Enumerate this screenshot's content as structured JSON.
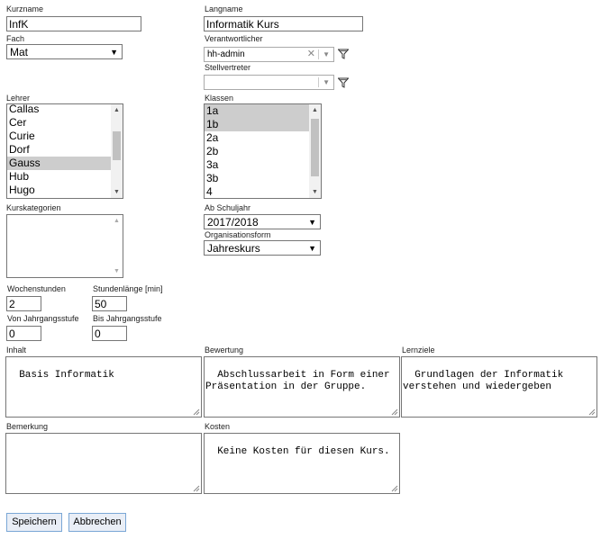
{
  "form": {
    "kurzname": {
      "label": "Kurzname",
      "value": "InfK"
    },
    "langname": {
      "label": "Langname",
      "value": "Informatik Kurs"
    },
    "fach": {
      "label": "Fach",
      "value": "Mat"
    },
    "verantwortlicher": {
      "label": "Verantwortlicher",
      "value": "hh-admin"
    },
    "stellvertreter": {
      "label": "Stellvertreter",
      "value": ""
    },
    "lehrer": {
      "label": "Lehrer",
      "options": [
        "Callas",
        "Cer",
        "Curie",
        "Dorf",
        "Gauss",
        "Hub",
        "Hugo"
      ],
      "selected": [
        "Gauss"
      ]
    },
    "klassen": {
      "label": "Klassen",
      "options": [
        "1a",
        "1b",
        "2a",
        "2b",
        "3a",
        "3b",
        "4"
      ],
      "selected": [
        "1a",
        "1b"
      ]
    },
    "kurskategorien": {
      "label": "Kurskategorien"
    },
    "ab_schuljahr": {
      "label": "Ab Schuljahr",
      "value": "2017/2018"
    },
    "organisationsform": {
      "label": "Organisationsform",
      "value": "Jahreskurs"
    },
    "wochenstunden": {
      "label": "Wochenstunden",
      "value": "2"
    },
    "stundenlaenge": {
      "label": "Stundenlänge [min]",
      "value": "50"
    },
    "von_jahrgangsstufe": {
      "label": "Von Jahrgangsstufe",
      "value": "0"
    },
    "bis_jahrgangsstufe": {
      "label": "Bis Jahrgangsstufe",
      "value": "0"
    },
    "inhalt": {
      "label": "Inhalt",
      "value": "Basis Informatik"
    },
    "bewertung": {
      "label": "Bewertung",
      "value": "Abschlussarbeit in Form einer Präsentation in der Gruppe."
    },
    "lernziele": {
      "label": "Lernziele",
      "value": "Grundlagen der Informatik verstehen und wiedergeben"
    },
    "bemerkung": {
      "label": "Bemerkung",
      "value": ""
    },
    "kosten": {
      "label": "Kosten",
      "value": "Keine Kosten für diesen Kurs."
    }
  },
  "buttons": {
    "save": "Speichern",
    "cancel": "Abbrechen"
  },
  "colors": {
    "selection": "#cdcdcd",
    "button_border": "#7aa7d6",
    "button_bg": "#e9eef6"
  },
  "icons": {
    "filter": "funnel-filter-icon",
    "clear": "clear-x-icon",
    "dropdown": "chevron-down-icon"
  }
}
